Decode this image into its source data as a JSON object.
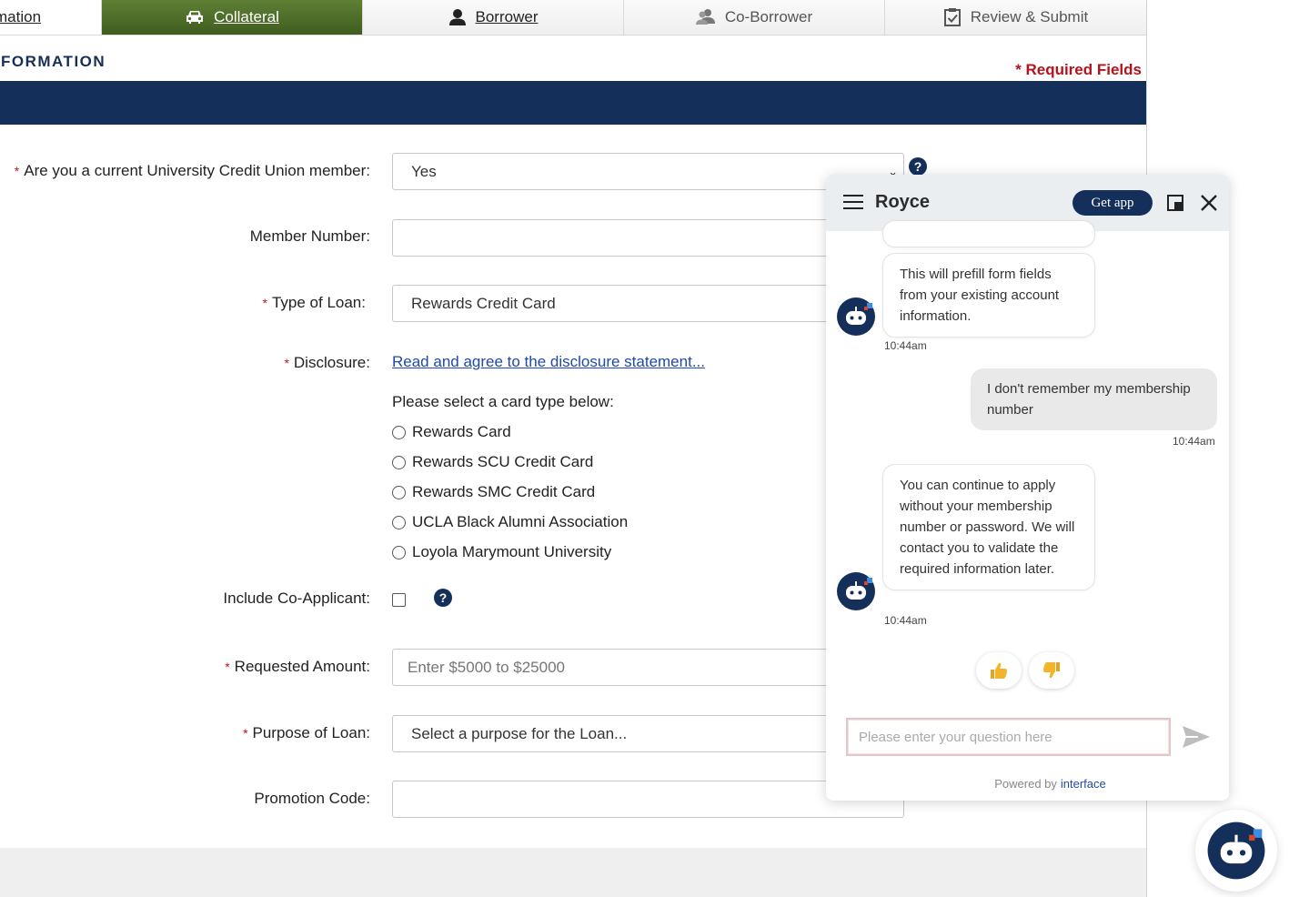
{
  "tabs": {
    "info": "mation",
    "collateral": "Collateral",
    "borrower": "Borrower",
    "coborrower": "Co-Borrower",
    "review": "Review & Submit"
  },
  "section_title": "FORMATION",
  "required_note": "* Required Fields",
  "form": {
    "member_q_label": "Are you a current University Credit Union member:",
    "member_q_value": "Yes",
    "member_number_label": "Member Number:",
    "member_number_value": "",
    "loan_type_label": "Type of Loan:",
    "loan_type_value": "Rewards Credit Card",
    "disclosure_label": "Disclosure:",
    "disclosure_link": "Read and agree to the disclosure statement...",
    "card_prompt": "Please select a card type below:",
    "card_options": [
      "Rewards Card",
      "Rewards SCU Credit Card",
      "Rewards SMC Credit Card",
      "UCLA Black Alumni Association",
      "Loyola Marymount University"
    ],
    "coapplicant_label": "Include Co-Applicant:",
    "amount_label": "Requested Amount:",
    "amount_placeholder": "Enter $5000 to $25000",
    "purpose_label": "Purpose of Loan:",
    "purpose_value": "Select a purpose for the Loan...",
    "promo_label": "Promotion Code:",
    "help_glyph": "?"
  },
  "chat": {
    "title": "Royce",
    "get_app": "Get app",
    "messages": [
      {
        "from": "bot",
        "text": "This will prefill form fields from your existing account information.",
        "time": "10:44am"
      },
      {
        "from": "user",
        "text": "I don't remember my membership number",
        "time": "10:44am"
      },
      {
        "from": "bot",
        "text": "You can continue to apply without your membership number or password. We will contact you to validate the required information later.",
        "time": "10:44am"
      }
    ],
    "input_placeholder": "Please enter your question here",
    "powered_by": "Powered by",
    "brand": "interface"
  },
  "icons": {
    "car": "car-icon",
    "person": "person-icon",
    "coborrower": "co-borrower-icon",
    "review": "checklist-icon",
    "bot": "bot-avatar-icon",
    "send": "send-icon"
  },
  "colors": {
    "navy": "#14305a",
    "green_tab": "#4f6e28",
    "required_red": "#b5121b",
    "link_blue": "#1f4aa8"
  }
}
